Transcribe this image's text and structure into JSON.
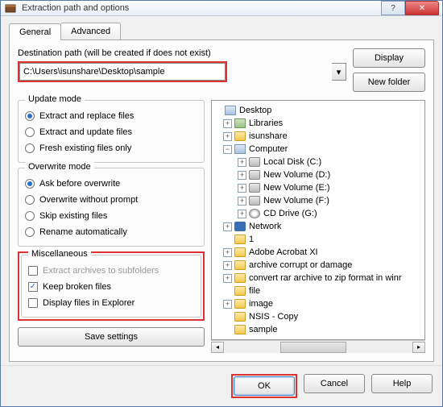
{
  "window": {
    "title": "Extraction path and options"
  },
  "tabs": {
    "general": "General",
    "advanced": "Advanced"
  },
  "dest": {
    "label": "Destination path (will be created if does not exist)",
    "value": "C:\\Users\\isunshare\\Desktop\\sample",
    "display_btn": "Display",
    "newfolder_btn": "New folder"
  },
  "update": {
    "title": "Update mode",
    "opt1": "Extract and replace files",
    "opt2": "Extract and update files",
    "opt3": "Fresh existing files only"
  },
  "overwrite": {
    "title": "Overwrite mode",
    "opt1": "Ask before overwrite",
    "opt2": "Overwrite without prompt",
    "opt3": "Skip existing files",
    "opt4": "Rename automatically"
  },
  "misc": {
    "title": "Miscellaneous",
    "opt1": "Extract archives to subfolders",
    "opt2": "Keep broken files",
    "opt3": "Display files in Explorer"
  },
  "save_btn": "Save settings",
  "tree": {
    "desktop": "Desktop",
    "libraries": "Libraries",
    "isunshare": "isunshare",
    "computer": "Computer",
    "localc": "Local Disk (C:)",
    "vold": "New Volume (D:)",
    "vole": "New Volume (E:)",
    "volf": "New Volume (F:)",
    "cdg": "CD Drive (G:)",
    "network": "Network",
    "one": "1",
    "acrobat": "Adobe Acrobat XI",
    "archive": "archive corrupt or damage",
    "convert": "convert rar archive to zip format in winr",
    "file": "file",
    "image": "image",
    "nsis": "NSIS - Copy",
    "sample": "sample"
  },
  "buttons": {
    "ok": "OK",
    "cancel": "Cancel",
    "help": "Help"
  }
}
